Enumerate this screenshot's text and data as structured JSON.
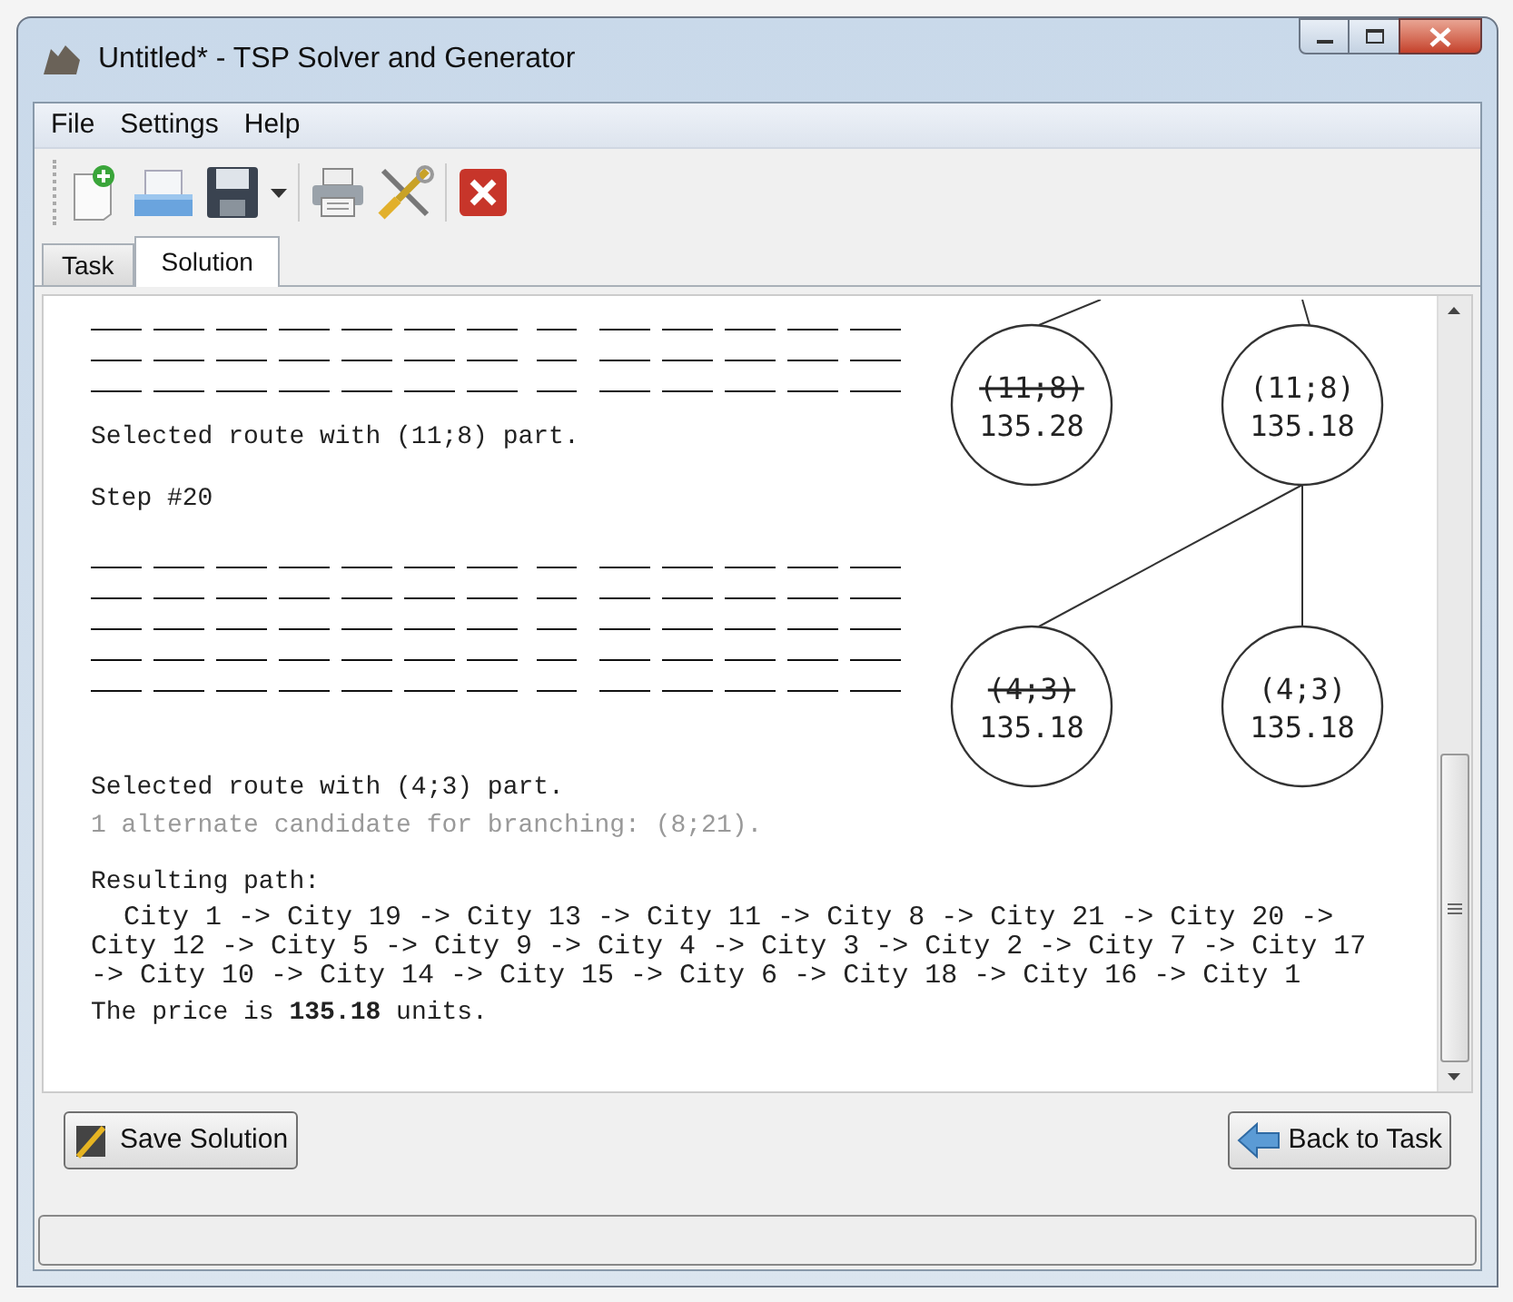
{
  "window": {
    "title": "Untitled* - TSP Solver and Generator"
  },
  "menu": [
    "File",
    "Settings",
    "Help"
  ],
  "tabs": [
    {
      "label": "Task",
      "selected": false
    },
    {
      "label": "Solution",
      "selected": true
    }
  ],
  "solution": {
    "upper": [
      {
        "kind": "grid",
        "rows": [
          {
            "kind": "blank"
          },
          {
            "kind": "blank"
          },
          {
            "kind": "blank"
          }
        ]
      },
      {
        "kind": "text",
        "text": "Selected route with (11;8) part."
      },
      {
        "kind": "text",
        "text": "Step #20"
      },
      {
        "kind": "grid",
        "rows": [
          {
            "kind": "blank"
          },
          {
            "kind": "blank"
          },
          {
            "kind": "blank"
          },
          {
            "kind": "blank"
          },
          {
            "kind": "blank"
          }
        ]
      }
    ],
    "tree": [
      {
        "label": "(11;8)",
        "value": "135.28",
        "crossed_out": true
      },
      {
        "label": "(11;8)",
        "value": "135.18",
        "crossed_out": false,
        "children": [
          {
            "label": "(4;3)",
            "value": "135.18",
            "crossed_out": true
          },
          {
            "label": "(4;3)",
            "value": "135.18",
            "crossed_out": false
          }
        ]
      }
    ],
    "lower": [
      {
        "kind": "text",
        "text": "Selected route with (4;3) part."
      },
      {
        "kind": "note",
        "text": "1 alternate candidate for branching: (8;21)."
      },
      {
        "kind": "text",
        "text": "Resulting path:"
      },
      {
        "kind": "path",
        "text": "City 1 -> City 19 -> City 13 -> City 11 -> City 8 -> City 21 -> City 20 -> City 12 -> City 5 -> City 9 -> City 4 -> City 3 -> City 2 -> City 7 -> City 17 -> City 10 -> City 14 -> City 15 -> City 6 -> City 18 -> City 16 -> City 1"
      },
      {
        "kind": "text",
        "text": "The price is **135.18** units."
      }
    ]
  },
  "buttons": {
    "save": "Save Solution",
    "back": "Back to Task"
  }
}
